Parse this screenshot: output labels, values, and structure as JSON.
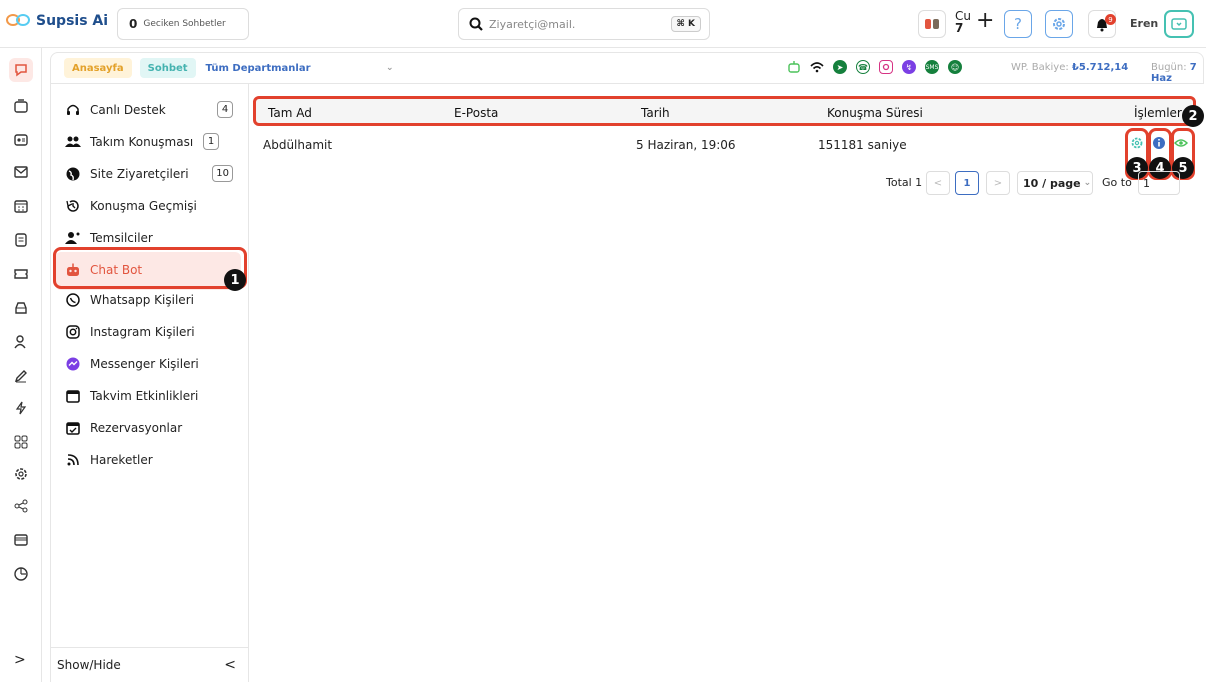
{
  "topbar": {
    "app_name": "Supsis Ai",
    "late_chats_count": "0",
    "late_chats_label": "Geciken Sohbetler",
    "search_placeholder": "Ziyaretçi@mail.",
    "search_shortcut": "⌘ K",
    "status_prefix": "Cu",
    "status_count": "7",
    "plus_label": "+",
    "help_label": "?",
    "notification_count": "9",
    "user_name": "Eren"
  },
  "subheader": {
    "home_label": "Anasayfa",
    "chat_label": "Sohbet",
    "department_select": "Tüm Departmanlar",
    "balance_label": "WP. Bakiye:",
    "balance_value": "₺5.712,14",
    "today_label": "Bugün:",
    "today_value": "7 Haz",
    "channels": [
      "bot",
      "wifi",
      "telegram",
      "whatsapp",
      "instagram",
      "messenger",
      "sms",
      "other"
    ]
  },
  "sidemenu": {
    "items": [
      {
        "label": "Canlı Destek",
        "icon": "headset-icon",
        "count": "4"
      },
      {
        "label": "Takım Konuşması",
        "icon": "team-icon",
        "count": "1"
      },
      {
        "label": "Site Ziyaretçileri",
        "icon": "globe-icon",
        "count": "10"
      },
      {
        "label": "Konuşma Geçmişi",
        "icon": "history-icon"
      },
      {
        "label": "Temsilciler",
        "icon": "agents-icon"
      },
      {
        "label": "Chat Bot",
        "icon": "robot-icon"
      },
      {
        "label": "Whatsapp Kişileri",
        "icon": "whatsapp-icon"
      },
      {
        "label": "Instagram Kişileri",
        "icon": "instagram-icon"
      },
      {
        "label": "Messenger Kişileri",
        "icon": "messenger-icon"
      },
      {
        "label": "Takvim Etkinlikleri",
        "icon": "calendar-icon"
      },
      {
        "label": "Rezervasyonlar",
        "icon": "reservation-icon"
      },
      {
        "label": "Hareketler",
        "icon": "feed-icon"
      }
    ],
    "active_index": 5,
    "show_hide_label": "Show/Hide"
  },
  "table": {
    "columns": [
      "Tam Ad",
      "E-Posta",
      "Tarih",
      "Konuşma Süresi",
      "İşlemler"
    ],
    "rows": [
      {
        "name": "Abdülhamit",
        "email": "",
        "date": "5 Haziran, 19:06",
        "duration": "151181 saniye"
      }
    ]
  },
  "pagination": {
    "total_label": "Total 1",
    "current_page": "1",
    "page_size": "10 / page",
    "goto_label": "Go to",
    "goto_value": "1"
  },
  "annotations": [
    "1",
    "2",
    "3",
    "4",
    "5"
  ],
  "colors": {
    "accent": "#e2553f",
    "highlight": "#e2412d",
    "link": "#3d6dc1",
    "teal": "#45c1b2"
  }
}
